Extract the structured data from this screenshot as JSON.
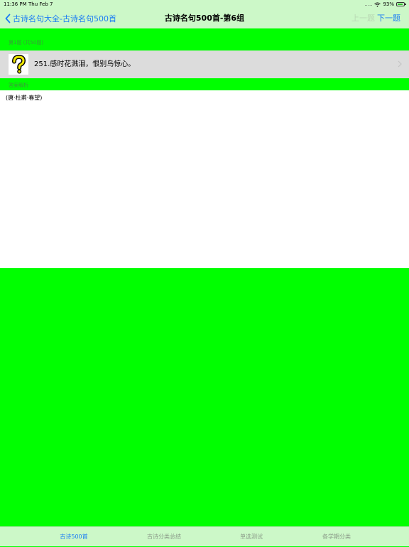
{
  "status_bar": {
    "time": "11:36 PM",
    "date": "Thu Feb 7",
    "battery": "93%",
    "battery_level": 0.93,
    "signal": "....."
  },
  "nav": {
    "back_label": "古诗名句大全-古诗名句500首",
    "title": "古诗名句500首-第6组",
    "prev_label": "上一题",
    "next_label": "下一题"
  },
  "question_section": {
    "header": "第1题 (共50题)",
    "question": "251.感时花溅泪，恨别鸟惊心。"
  },
  "answer_section": {
    "header": "答案解析",
    "answer": "(唐·杜甫·春望)"
  },
  "tabs": [
    {
      "label": "古诗500首",
      "active": true
    },
    {
      "label": "古诗分类总结",
      "active": false
    },
    {
      "label": "单选测试",
      "active": false
    },
    {
      "label": "各学期分类",
      "active": false
    }
  ],
  "colors": {
    "accent": "#1a7cf5",
    "bar_bg": "#ccf8c8",
    "page_bg": "#00ff00"
  },
  "icons": {
    "back": "chevron-left-icon",
    "question": "question-mark-icon",
    "row": "chevron-right-icon",
    "wifi": "wifi-icon",
    "battery": "battery-icon"
  }
}
